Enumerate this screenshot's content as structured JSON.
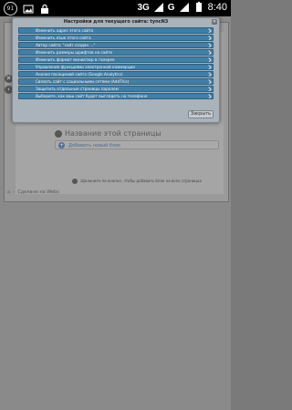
{
  "status_bar": {
    "badge": "91",
    "network": "3G",
    "network_small": "G",
    "time": "8:40"
  },
  "dialog": {
    "title": "Настройки для текущего сайта: tyncN3",
    "items": [
      "Изменить адрес этого сайта",
      "Изменить язык этого сайта",
      "Автор сайта: \"сайт создан ...\"",
      "Изменить размеры шрифтов на сайте",
      "Изменить формат миниатюр в галерее",
      "Управление функциями электронной коммерции",
      "Анализ посещений сайта (Google Analytics)",
      "Связать сайт с социальными сетями (AddThis)",
      "Защитить отдельные страницы паролем",
      "Выберите, как ваш сайт будет выглядеть на телефоне"
    ],
    "close_label": "Закрыть"
  },
  "background": {
    "section_title": "Название этой страницы",
    "add_block_label": "Добавить новый блок",
    "bottom_strip": "Щелкните по кнопке, чтобы добавить блок на всех страницах",
    "crumb": "Сделано на Webs"
  }
}
